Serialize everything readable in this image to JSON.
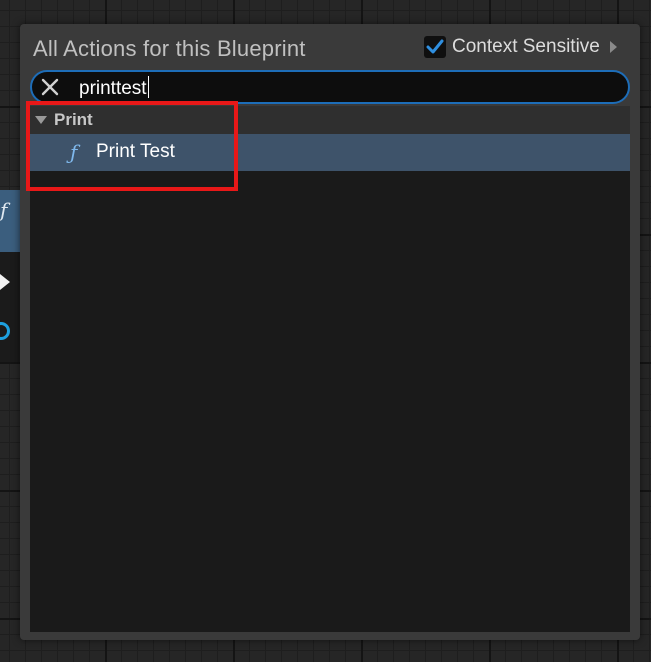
{
  "menu": {
    "title": "All Actions for this Blueprint",
    "context_sensitive": {
      "label": "Context Sensitive",
      "checked": true
    }
  },
  "search": {
    "value": "printtest"
  },
  "results": {
    "categories": [
      {
        "label": "Print",
        "expanded": true,
        "items": [
          {
            "label": "Print Test",
            "icon": "function-icon"
          }
        ]
      }
    ]
  },
  "colors": {
    "accent": "#1d6db8",
    "selection": "#3e536a",
    "highlight_annotation": "#e81818"
  }
}
